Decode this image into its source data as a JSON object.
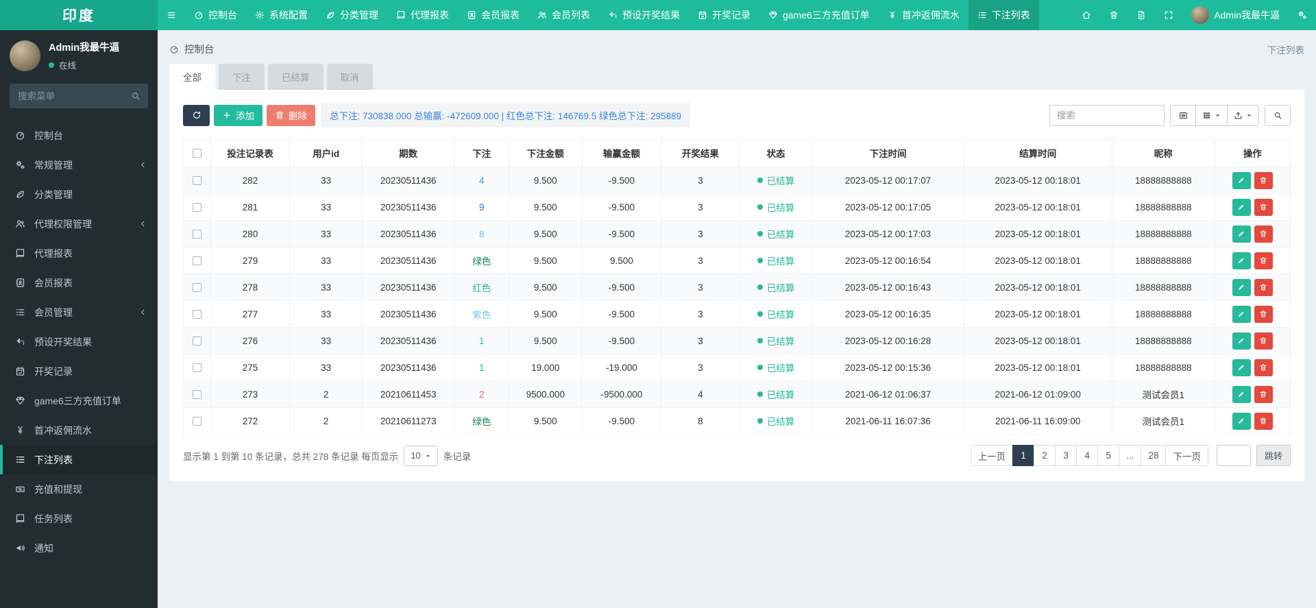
{
  "brand": "印度",
  "navbar": {
    "items": [
      {
        "id": "console",
        "icon": "dash",
        "label": "控制台"
      },
      {
        "id": "system-config",
        "icon": "gear",
        "label": "系统配置"
      },
      {
        "id": "category",
        "icon": "leaf",
        "label": "分类管理"
      },
      {
        "id": "agent-report",
        "icon": "book",
        "label": "代理报表"
      },
      {
        "id": "member-report",
        "icon": "idcard",
        "label": "会员报表"
      },
      {
        "id": "member-list",
        "icon": "users",
        "label": "会员列表"
      },
      {
        "id": "preset-result",
        "icon": "hand",
        "label": "预设开奖结果"
      },
      {
        "id": "draw-record",
        "icon": "cal",
        "label": "开奖记录"
      },
      {
        "id": "game6-orders",
        "icon": "gem",
        "label": "game6三方充值订单"
      },
      {
        "id": "first-charge",
        "icon": "yen",
        "label": "首冲返佣流水"
      },
      {
        "id": "bet-list",
        "icon": "list",
        "label": "下注列表",
        "active": true
      }
    ],
    "right_icons": [
      {
        "id": "home",
        "icon": "home"
      },
      {
        "id": "trash",
        "icon": "trash"
      },
      {
        "id": "cache",
        "icon": "file"
      },
      {
        "id": "fullscreen",
        "icon": "expand"
      }
    ],
    "user": {
      "name": "Admin我最牛逼"
    }
  },
  "sidebar": {
    "user": {
      "name": "Admin我最牛逼",
      "status": "在线"
    },
    "search_placeholder": "搜索菜单",
    "items": [
      {
        "icon": "dash",
        "label": "控制台"
      },
      {
        "icon": "gears",
        "label": "常规管理",
        "children": true
      },
      {
        "icon": "leaf",
        "label": "分类管理"
      },
      {
        "icon": "users",
        "label": "代理权限管理",
        "children": true
      },
      {
        "icon": "book",
        "label": "代理报表"
      },
      {
        "icon": "idcard",
        "label": "会员报表"
      },
      {
        "icon": "list",
        "label": "会员管理",
        "children": true
      },
      {
        "icon": "hand",
        "label": "预设开奖结果"
      },
      {
        "icon": "cal",
        "label": "开奖记录"
      },
      {
        "icon": "gem",
        "label": "game6三方充值订单"
      },
      {
        "icon": "yen",
        "label": "首冲返佣流水"
      },
      {
        "icon": "list",
        "label": "下注列表",
        "active": true
      },
      {
        "icon": "money",
        "label": "充值和提现"
      },
      {
        "icon": "book",
        "label": "任务列表"
      },
      {
        "icon": "bullhorn",
        "label": "通知"
      }
    ]
  },
  "breadcrumb": {
    "left": "控制台",
    "right": "下注列表"
  },
  "tabs": [
    {
      "label": "全部",
      "active": true
    },
    {
      "label": "下注"
    },
    {
      "label": "已结算"
    },
    {
      "label": "取消"
    }
  ],
  "toolbar": {
    "add_label": "添加",
    "delete_label": "删除",
    "summary": "总下注: 730838.000 总输赢: -472609.000 | 红色总下注: 146769.5 绿色总下注: 295889"
  },
  "search": {
    "placeholder": "搜索"
  },
  "table": {
    "columns": [
      "投注记录表",
      "用户id",
      "期数",
      "下注",
      "下注金额",
      "输赢金额",
      "开奖结果",
      "状态",
      "下注时间",
      "结算时间",
      "昵称",
      "操作"
    ],
    "rows": [
      {
        "record": "282",
        "user": "33",
        "period": "20230511436",
        "bet": "4",
        "bet_color": "#3b97e8",
        "amount": "9.500",
        "win": "-9.500",
        "result": "3",
        "status": "已结算",
        "bet_time": "2023-05-12 00:17:07",
        "settle_time": "2023-05-12 00:18:01",
        "nickname": "18888888888"
      },
      {
        "record": "281",
        "user": "33",
        "period": "20230511436",
        "bet": "9",
        "bet_color": "#2f6fb5",
        "amount": "9.500",
        "win": "-9.500",
        "result": "3",
        "status": "已结算",
        "bet_time": "2023-05-12 00:17:05",
        "settle_time": "2023-05-12 00:18:01",
        "nickname": "18888888888"
      },
      {
        "record": "280",
        "user": "33",
        "period": "20230511436",
        "bet": "8",
        "bet_color": "#6fb5ef",
        "amount": "9.500",
        "win": "-9.500",
        "result": "3",
        "status": "已结算",
        "bet_time": "2023-05-12 00:17:03",
        "settle_time": "2023-05-12 00:18:01",
        "nickname": "18888888888"
      },
      {
        "record": "279",
        "user": "33",
        "period": "20230511436",
        "bet": "绿色",
        "bet_color": "#0d8a4f",
        "amount": "9.500",
        "win": "9.500",
        "result": "3",
        "status": "已结算",
        "bet_time": "2023-05-12 00:16:54",
        "settle_time": "2023-05-12 00:18:01",
        "nickname": "18888888888"
      },
      {
        "record": "278",
        "user": "33",
        "period": "20230511436",
        "bet": "红色",
        "bet_color": "#2cb795",
        "amount": "9.500",
        "win": "-9.500",
        "result": "3",
        "status": "已结算",
        "bet_time": "2023-05-12 00:16:43",
        "settle_time": "2023-05-12 00:18:01",
        "nickname": "18888888888"
      },
      {
        "record": "277",
        "user": "33",
        "period": "20230511436",
        "bet": "紫色",
        "bet_color": "#6ecadd",
        "amount": "9.500",
        "win": "-9.500",
        "result": "3",
        "status": "已结算",
        "bet_time": "2023-05-12 00:16:35",
        "settle_time": "2023-05-12 00:18:01",
        "nickname": "18888888888"
      },
      {
        "record": "276",
        "user": "33",
        "period": "20230511436",
        "bet": "1",
        "bet_color": "#1db8a5",
        "amount": "9.500",
        "win": "-9.500",
        "result": "3",
        "status": "已结算",
        "bet_time": "2023-05-12 00:16:28",
        "settle_time": "2023-05-12 00:18:01",
        "nickname": "18888888888"
      },
      {
        "record": "275",
        "user": "33",
        "period": "20230511436",
        "bet": "1",
        "bet_color": "#1db8a5",
        "amount": "19.000",
        "win": "-19.000",
        "result": "3",
        "status": "已结算",
        "bet_time": "2023-05-12 00:15:36",
        "settle_time": "2023-05-12 00:18:01",
        "nickname": "18888888888"
      },
      {
        "record": "273",
        "user": "2",
        "period": "20210611453",
        "bet": "2",
        "bet_color": "#e8695a",
        "amount": "9500.000",
        "win": "-9500.000",
        "result": "4",
        "status": "已结算",
        "bet_time": "2021-06-12 01:06:37",
        "settle_time": "2021-06-12 01:09:00",
        "nickname": "测试会员1"
      },
      {
        "record": "272",
        "user": "2",
        "period": "20210611273",
        "bet": "绿色",
        "bet_color": "#0d8a4f",
        "amount": "9.500",
        "win": "-9.500",
        "result": "8",
        "status": "已结算",
        "bet_time": "2021-06-11 16:07:36",
        "settle_time": "2021-06-11 16:09:00",
        "nickname": "测试会员1"
      }
    ]
  },
  "pagination": {
    "info_prefix": "显示第 1 到第 10 条记录，总共 278 条记录 每页显示",
    "page_size": "10",
    "info_suffix": "条记录",
    "pages": [
      "上一页",
      "1",
      "2",
      "3",
      "4",
      "5",
      "...",
      "28",
      "下一页"
    ],
    "active_page": "1",
    "jump_label": "跳转"
  },
  "colors": {
    "navbar_teal": "#1dbc9c",
    "logo_teal": "#17a78b",
    "sidebar_dark": "#222d32",
    "active_page_bg": "#2c3e50",
    "success_green": "#26b99a",
    "danger_red": "#e3493c",
    "delete_btn_salmon": "#ee7d70",
    "summary_blue": "#3c82d8",
    "content_bg": "#ecf0f5"
  }
}
